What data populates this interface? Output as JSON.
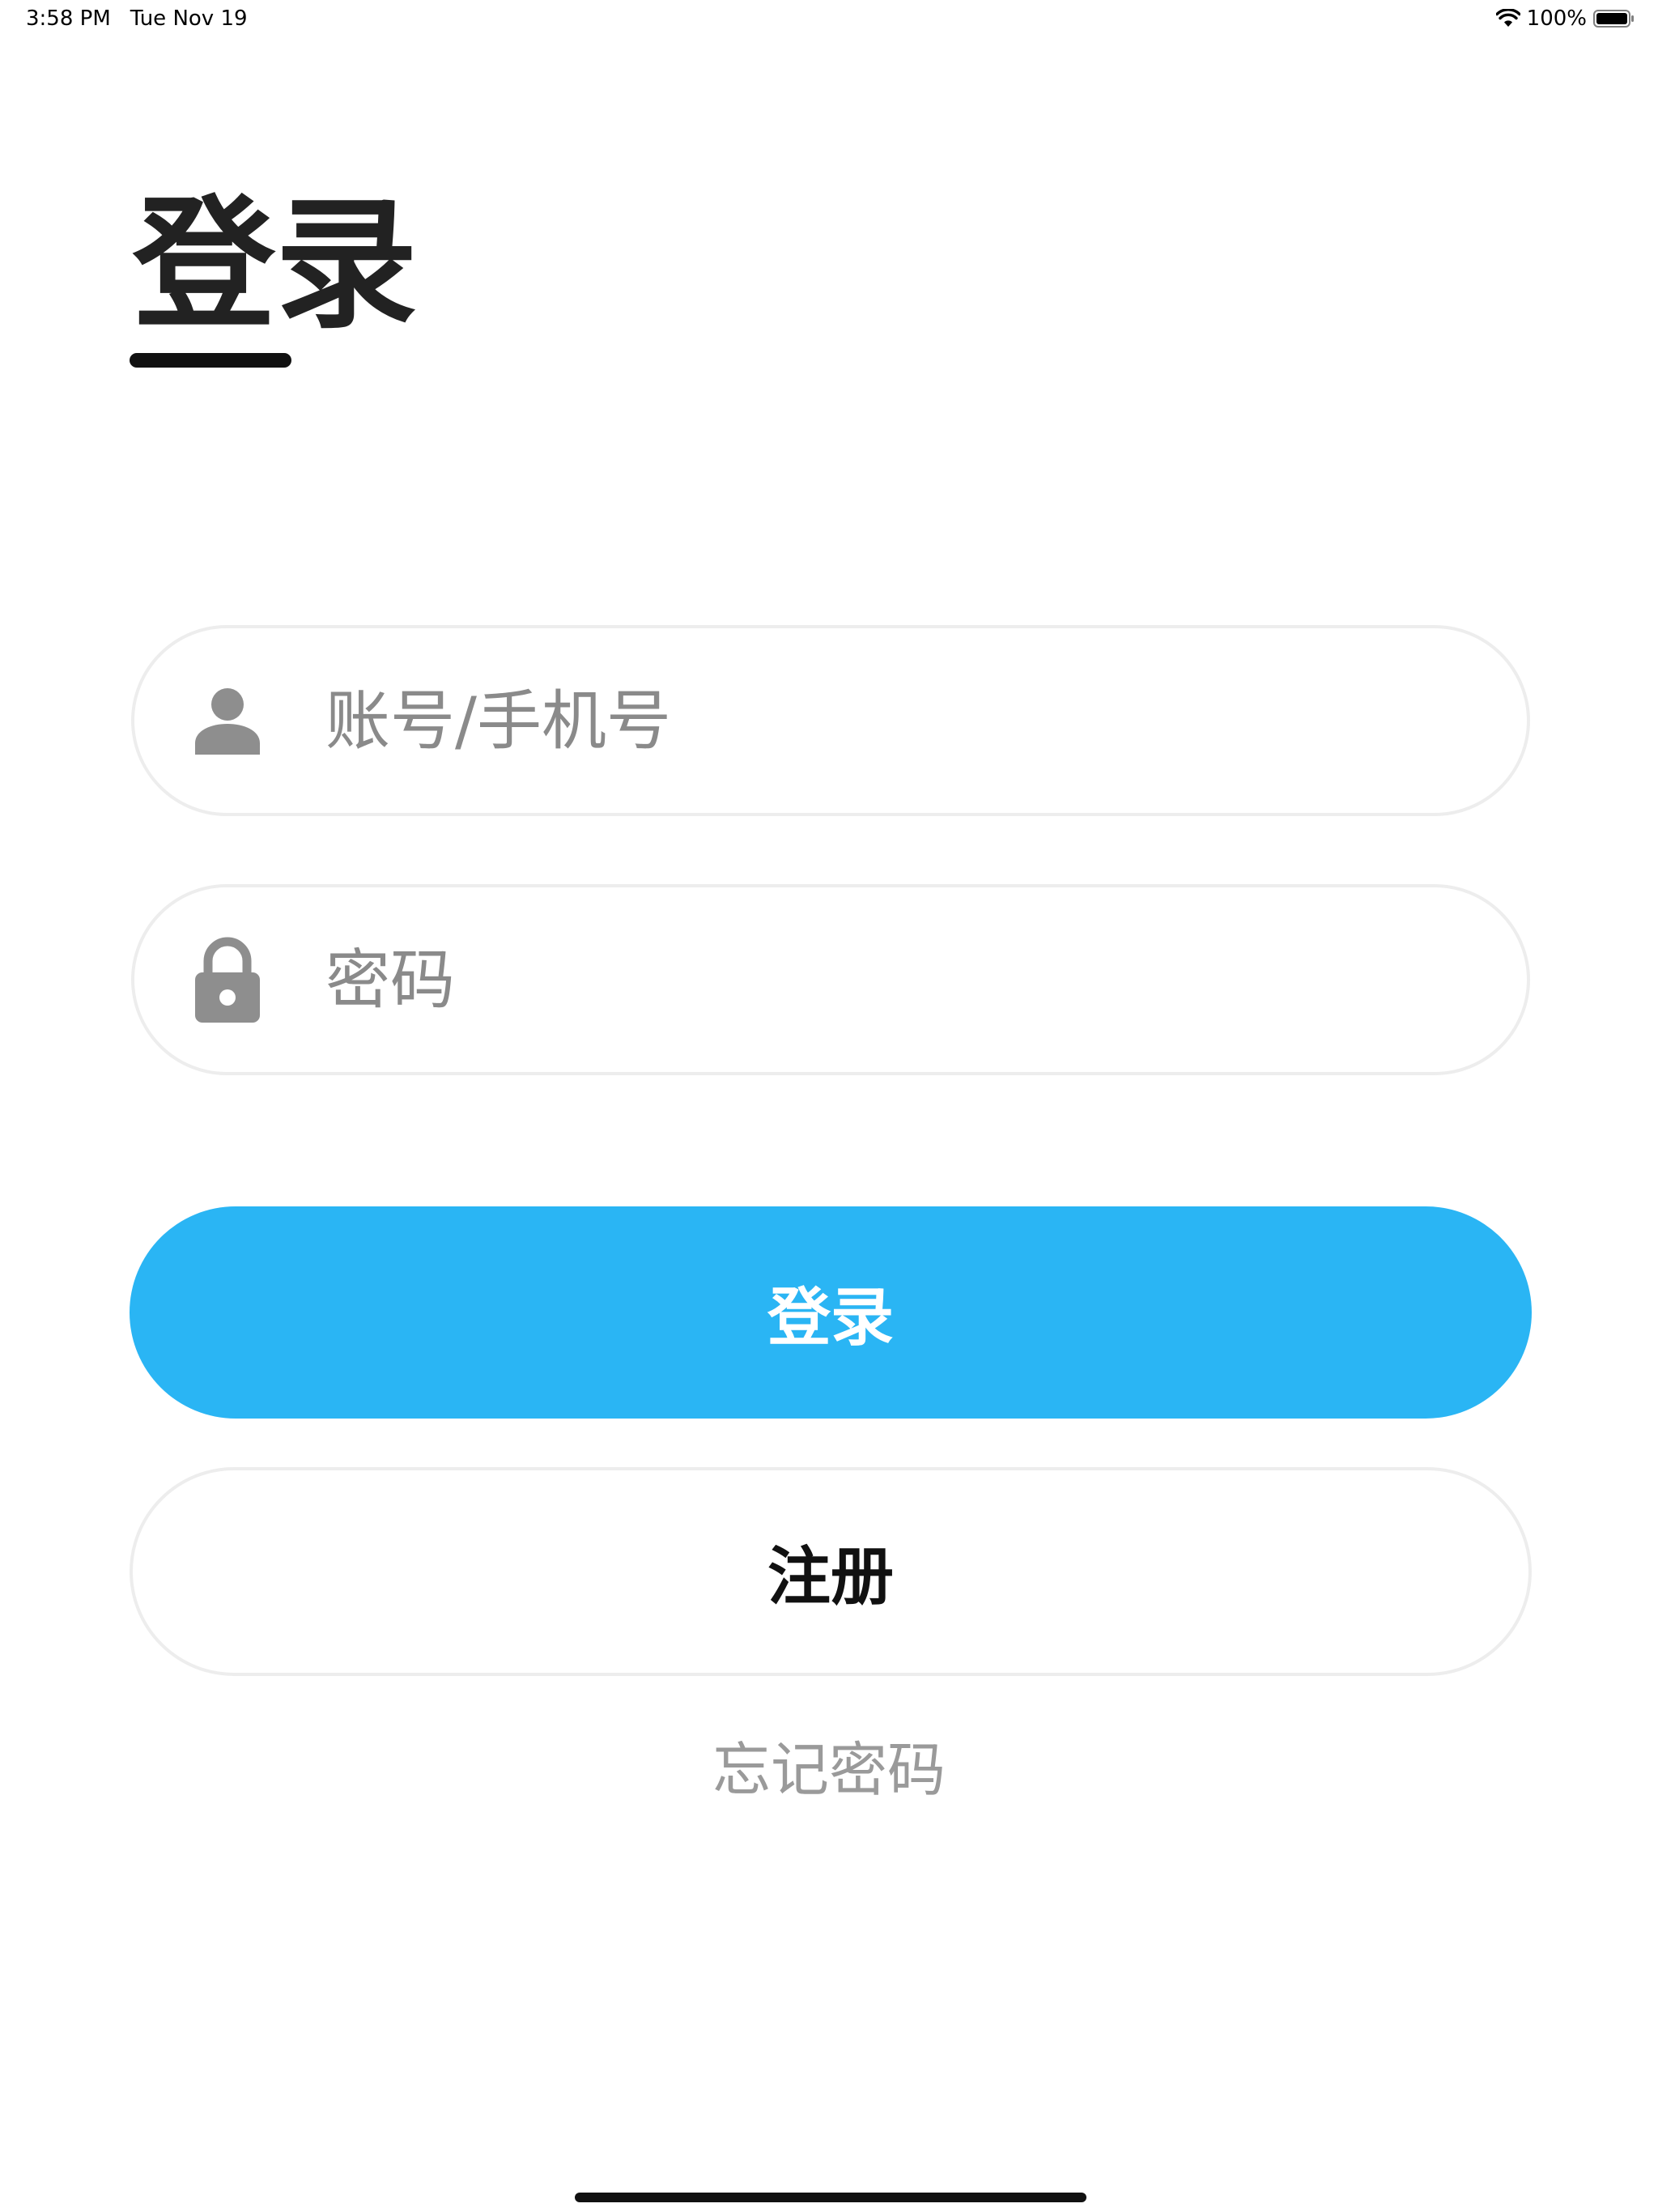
{
  "status_bar": {
    "time": "3:58 PM",
    "date": "Tue Nov 19",
    "battery": "100%"
  },
  "page": {
    "title": "登录"
  },
  "form": {
    "account_placeholder": "账号/手机号",
    "account_value": "",
    "password_placeholder": "密码",
    "password_value": "",
    "account_icon": "user-icon",
    "password_icon": "lock-icon"
  },
  "buttons": {
    "login_label": "登录",
    "register_label": "注册",
    "forgot_label": "忘记密码"
  },
  "colors": {
    "accent": "#2ab5f4",
    "title_text": "#222222",
    "placeholder": "#8a8a8a",
    "icon": "#8e8e8e",
    "field_border": "#ededed",
    "forgot_text": "#9a9a9a"
  }
}
